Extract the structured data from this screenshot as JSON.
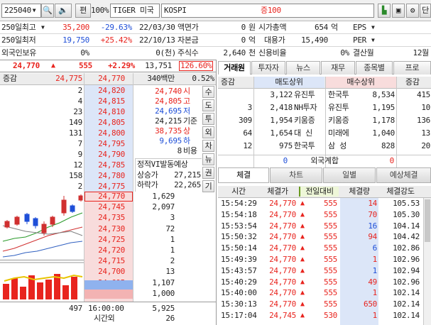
{
  "toolbar": {
    "code": "225040",
    "dropdown_icon": "▼",
    "search_icon": "🔍",
    "speaker_icon": "🔈",
    "edit_label": "편",
    "percent_label": "100%",
    "name": "TIGER 미국S&",
    "market": "KOSPI",
    "tag": "증100",
    "layout_icon": "▙",
    "save_icon": "▣",
    "settings_icon": "⚙",
    "last_label": "단"
  },
  "info": {
    "row1": {
      "label": "250일최고",
      "dd": "▼",
      "price": "35,200",
      "pct": "-29.63%",
      "date": "22/03/30",
      "k1": "액면가",
      "v1": "0",
      "u1": "원",
      "k2": "시가총액",
      "v2": "654",
      "u2": "억",
      "k3": "EPS",
      "dd3": "▼"
    },
    "row2": {
      "label": "250일최저",
      "price": "19,750",
      "pct": "+25.42%",
      "date": "22/10/13",
      "k1": "자본금",
      "v1": "0",
      "u1": "억",
      "k2": "대용가",
      "v2": "15,490",
      "k3": "PER",
      "dd3": "▼"
    },
    "row3": {
      "label": "외국인보유",
      "v0": "0%",
      "v1": "0(천)",
      "k1": "주식수",
      "v2": "2,640",
      "u2": "천",
      "k2": "신용비율",
      "v3": "0%",
      "k3": "결산월",
      "v4": "12월"
    }
  },
  "status": {
    "price": "24,770",
    "arrow": "▲",
    "change": "555",
    "pct": "+2.29%",
    "volume": "13,751",
    "ratio": "126.60%"
  },
  "orderbook": {
    "head_diff": "증감",
    "head_price1": "24,775",
    "head_price2": "24,770",
    "head_amount": "340백만",
    "head_pct": "0.52%",
    "asks": [
      {
        "qty": "2",
        "price": "24,820"
      },
      {
        "qty": "4",
        "price": "24,815"
      },
      {
        "qty": "23",
        "price": "24,810"
      },
      {
        "qty": "149",
        "price": "24,805"
      },
      {
        "qty": "131",
        "price": "24,800"
      },
      {
        "qty": "7",
        "price": "24,795"
      },
      {
        "qty": "9",
        "price": "24,790"
      },
      {
        "qty": "12",
        "price": "24,785"
      },
      {
        "qty": "158",
        "price": "24,780"
      },
      {
        "qty": "2",
        "price": "24,775"
      }
    ],
    "bids": [
      {
        "price": "24,770",
        "qty": "1,629"
      },
      {
        "price": "24,745",
        "qty": "2,097"
      },
      {
        "price": "24,735",
        "qty": "3"
      },
      {
        "price": "24,730",
        "qty": "72"
      },
      {
        "price": "24,725",
        "qty": "1"
      },
      {
        "price": "24,720",
        "qty": "1"
      },
      {
        "price": "24,715",
        "qty": "2"
      },
      {
        "price": "24,700",
        "qty": "13"
      },
      {
        "price": "24,695",
        "qty": "1,107"
      },
      {
        "price": "24,690",
        "qty": "1,000"
      }
    ],
    "summary": [
      {
        "value": "24,740",
        "label": "시"
      },
      {
        "value": "24,805",
        "label": "고"
      },
      {
        "value": "24,695",
        "label": "저"
      },
      {
        "value": "24,215",
        "label": "기준"
      },
      {
        "value": "38,735",
        "label": "상"
      },
      {
        "value": "9,695",
        "label": "하"
      },
      {
        "value": "8",
        "label": "비용"
      }
    ],
    "vi": {
      "title": "정적VI발동예상",
      "up_label": "상승가",
      "up_value": "27,215",
      "down_label": "하락가",
      "down_value": "22,265"
    },
    "side_buttons": [
      "수",
      "도",
      "투",
      "외",
      "차",
      "뉴",
      "권",
      "기"
    ],
    "footer": {
      "total_ask": "497",
      "time": "16:00:00",
      "total_bid": "5,925",
      "after_label": "시간외",
      "after_value": "26"
    }
  },
  "tabs": [
    "거래원",
    "투자자",
    "뉴스",
    "재무",
    "종목별",
    "프로"
  ],
  "broker": {
    "head_diff1": "증감",
    "head_sell": "매도상위",
    "head_buy": "매수상위",
    "head_diff2": "증감",
    "rows": [
      {
        "d1": "",
        "sell_qty": "3,122",
        "sell_name": "유진투",
        "buy_name": "한국투",
        "buy_qty": "8,534",
        "d2": "415"
      },
      {
        "d1": "3",
        "sell_qty": "2,418",
        "sell_name": "NH투자",
        "buy_name": "유진투",
        "buy_qty": "1,195",
        "d2": "10"
      },
      {
        "d1": "309",
        "sell_qty": "1,954",
        "sell_name": "키움증",
        "buy_name": "키움증",
        "buy_qty": "1,178",
        "d2": "136"
      },
      {
        "d1": "64",
        "sell_qty": "1,654",
        "sell_name": "대 신",
        "buy_name": "미래에",
        "buy_qty": "1,040",
        "d2": "13"
      },
      {
        "d1": "12",
        "sell_qty": "975",
        "sell_name": "한국투",
        "buy_name": "삼 성",
        "buy_qty": "828",
        "d2": "20"
      }
    ],
    "foreign": {
      "left": "0",
      "label": "외국계합",
      "right": "0"
    }
  },
  "trade_tabs": [
    "체결",
    "차트",
    "일별",
    "예상체결"
  ],
  "trades": {
    "headers": [
      "시간",
      "체결가",
      "전일대비",
      "체결량",
      "체결강도"
    ],
    "rows": [
      {
        "time": "15:54:29",
        "price": "24,770",
        "arrow": "▲",
        "diff": "555",
        "qty": "14",
        "strength": "105.53",
        "side": "buy"
      },
      {
        "time": "15:54:18",
        "price": "24,770",
        "arrow": "▲",
        "diff": "555",
        "qty": "70",
        "strength": "105.30",
        "side": "buy"
      },
      {
        "time": "15:53:54",
        "price": "24,770",
        "arrow": "▲",
        "diff": "555",
        "qty": "16",
        "strength": "104.14",
        "side": "sell"
      },
      {
        "time": "15:50:32",
        "price": "24,770",
        "arrow": "▲",
        "diff": "555",
        "qty": "94",
        "strength": "104.42",
        "side": "buy"
      },
      {
        "time": "15:50:14",
        "price": "24,770",
        "arrow": "▲",
        "diff": "555",
        "qty": "6",
        "strength": "102.86",
        "side": "sell"
      },
      {
        "time": "15:49:39",
        "price": "24,770",
        "arrow": "▲",
        "diff": "555",
        "qty": "1",
        "strength": "102.96",
        "side": "buy"
      },
      {
        "time": "15:43:57",
        "price": "24,770",
        "arrow": "▲",
        "diff": "555",
        "qty": "1",
        "strength": "102.94",
        "side": "sell"
      },
      {
        "time": "15:40:29",
        "price": "24,770",
        "arrow": "▲",
        "diff": "555",
        "qty": "49",
        "strength": "102.96",
        "side": "buy"
      },
      {
        "time": "15:40:00",
        "price": "24,770",
        "arrow": "▲",
        "diff": "555",
        "qty": "1",
        "strength": "102.14",
        "side": "buy"
      },
      {
        "time": "15:30:13",
        "price": "24,770",
        "arrow": "▲",
        "diff": "555",
        "qty": "650",
        "strength": "102.14",
        "side": "buy"
      },
      {
        "time": "15:17:04",
        "price": "24,745",
        "arrow": "▲",
        "diff": "530",
        "qty": "1",
        "strength": "102.14",
        "side": "buy"
      }
    ]
  },
  "colors": {
    "up": "#e8241e",
    "down": "#1f4fd8",
    "ask_bg": "#dce6f8",
    "bid_bg": "#f8dcdc"
  }
}
